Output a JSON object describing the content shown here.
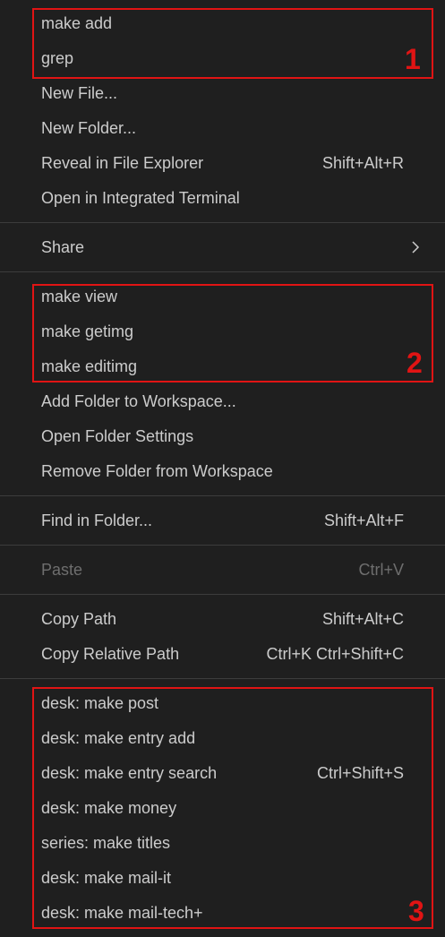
{
  "items": [
    {
      "label": "make add"
    },
    {
      "label": "grep"
    },
    {
      "label": "New File..."
    },
    {
      "label": "New Folder..."
    },
    {
      "label": "Reveal in File Explorer",
      "shortcut": "Shift+Alt+R"
    },
    {
      "label": "Open in Integrated Terminal"
    },
    {
      "label": "Share"
    },
    {
      "label": "make view"
    },
    {
      "label": "make getimg"
    },
    {
      "label": "make editimg"
    },
    {
      "label": "Add Folder to Workspace..."
    },
    {
      "label": "Open Folder Settings"
    },
    {
      "label": "Remove Folder from Workspace"
    },
    {
      "label": "Find in Folder...",
      "shortcut": "Shift+Alt+F"
    },
    {
      "label": "Paste",
      "shortcut": "Ctrl+V"
    },
    {
      "label": "Copy Path",
      "shortcut": "Shift+Alt+C"
    },
    {
      "label": "Copy Relative Path",
      "shortcut": "Ctrl+K Ctrl+Shift+C"
    },
    {
      "label": "desk: make post"
    },
    {
      "label": "desk: make entry add"
    },
    {
      "label": "desk: make entry search",
      "shortcut": "Ctrl+Shift+S"
    },
    {
      "label": "desk: make money"
    },
    {
      "label": "series: make titles"
    },
    {
      "label": "desk: make mail-it"
    },
    {
      "label": "desk: make mail-tech+"
    }
  ],
  "annotations": {
    "group1": "1",
    "group2": "2",
    "group3": "3"
  },
  "colors": {
    "background": "#1f1f1f",
    "text": "#cccccc",
    "disabled_text": "#6e6e6e",
    "separator": "#3c3c3c",
    "annotation": "#e01414"
  }
}
